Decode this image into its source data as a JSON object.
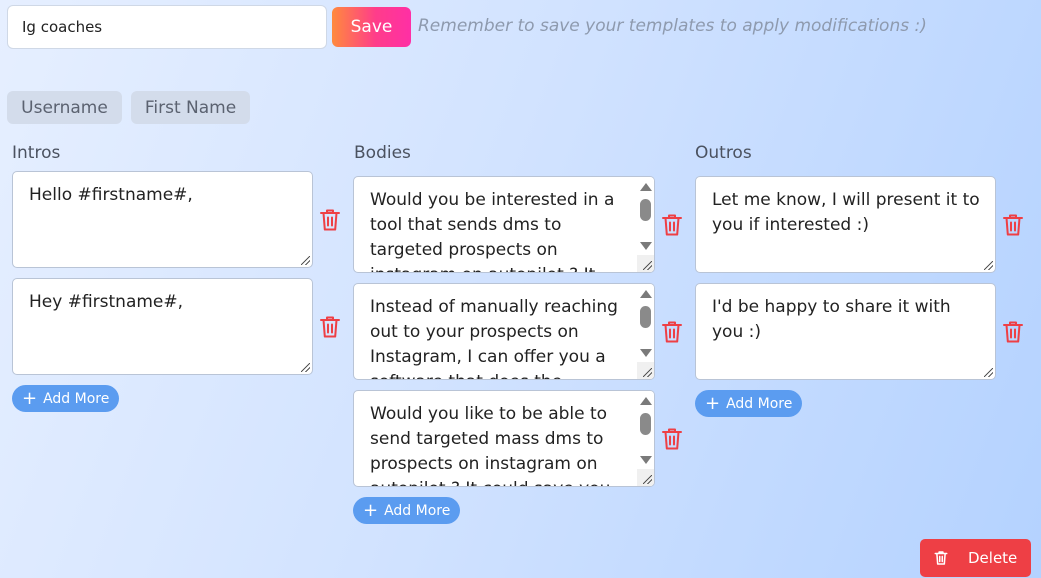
{
  "template": {
    "name_value": "Ig coaches"
  },
  "toolbar": {
    "save_label": "Save",
    "hint": "Remember to save your templates to apply modifications :)"
  },
  "variables": [
    {
      "label": "Username"
    },
    {
      "label": "First Name"
    }
  ],
  "intros": {
    "title": "Intros",
    "items": [
      {
        "text": "Hello #firstname#,"
      },
      {
        "text": "Hey #firstname#,"
      }
    ],
    "add_label": "Add More"
  },
  "bodies": {
    "title": "Bodies",
    "items": [
      {
        "text": "Would you be interested in a tool that sends dms to targeted prospects on instagram on autopilot ? It also"
      },
      {
        "text": "Instead of manually reaching out to your prospects on Instagram, I can offer you a software that does the"
      },
      {
        "text": "Would you like to be able to send targeted mass dms to prospects on instagram on autopilot ? It could save you"
      }
    ],
    "add_label": "Add More"
  },
  "outros": {
    "title": "Outros",
    "items": [
      {
        "text": "Let me know, I will present it to you if interested :)"
      },
      {
        "text": "I'd be happy to share it with you :)"
      }
    ],
    "add_label": "Add More"
  },
  "footer": {
    "delete_label": "Delete"
  },
  "icons": {
    "trash": "trash-icon",
    "plus": "plus-icon"
  },
  "colors": {
    "accent": "#5b9cf0",
    "danger": "#ee3f45",
    "save_from": "#ff8a3d",
    "save_to": "#ff2fa5"
  }
}
